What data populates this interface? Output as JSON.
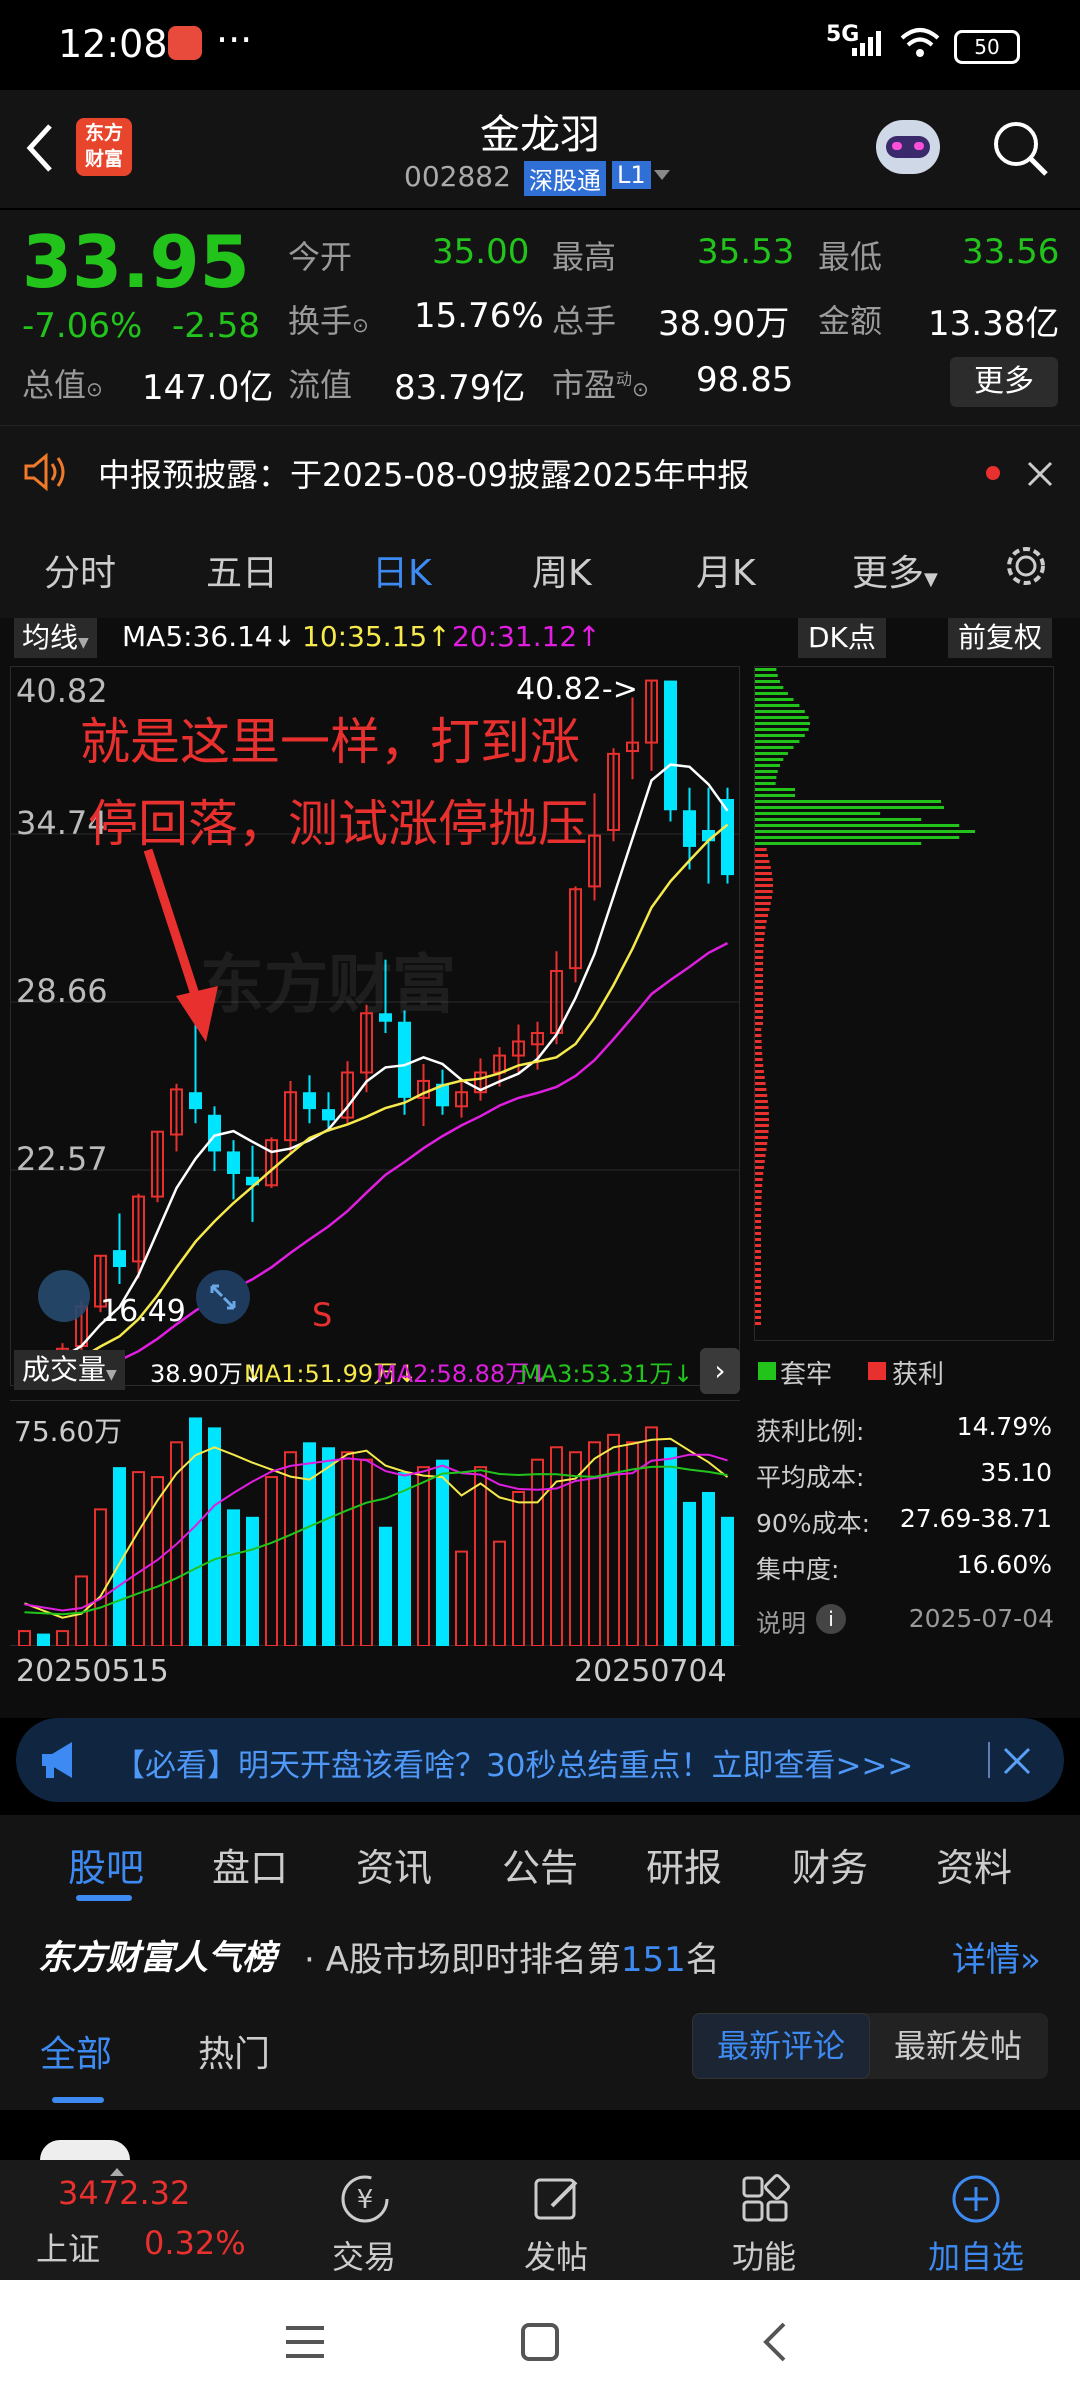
{
  "status_bar": {
    "time": "12:08",
    "dots": "···",
    "network": "5G",
    "battery": "50"
  },
  "header": {
    "title": "金龙羽",
    "code": "002882",
    "badge1": "深股通",
    "badge2": "L1",
    "logo_text": "东方财富"
  },
  "quote": {
    "price": "33.95",
    "change_pct": "-7.06%",
    "change": "-2.58",
    "open_label": "今开",
    "open_val": "35.00",
    "high_label": "最高",
    "high_val": "35.53",
    "low_label": "最低",
    "low_val": "33.56",
    "turnover_label": "换手",
    "turnover_val": "15.76%",
    "volume_label": "总手",
    "volume_val": "38.90万",
    "amount_label": "金额",
    "amount_val": "13.38亿",
    "mktcap_label": "总值",
    "mktcap_val": "147.0亿",
    "float_label": "流值",
    "float_val": "83.79亿",
    "pe_label": "市盈",
    "pe_sup": "动",
    "pe_val": "98.85",
    "more": "更多"
  },
  "notice": {
    "text": "中报预披露：于2025-08-09披露2025年中报"
  },
  "period_tabs": [
    "分时",
    "五日",
    "日K",
    "周K",
    "月K",
    "更多"
  ],
  "chart_toolbar": {
    "ma_select": "均线",
    "ma5": "MA5:36.14↓",
    "ma10": "10:35.15↑",
    "ma20": "20:31.12↑",
    "dk": "DK点",
    "fq": "前复权"
  },
  "price_axis": [
    "40.82",
    "34.74",
    "28.66",
    "22.57"
  ],
  "annotation": {
    "line1": "就是这里一样，打到涨",
    "line2": "停回落，测试涨停抛压"
  },
  "price_marks": {
    "high": "40.82->",
    "low": "16.49",
    "s_mark": "S"
  },
  "vol_toolbar": {
    "select": "成交量",
    "vol": "38.90万↓",
    "ma1": "MA1:51.99万↓",
    "ma2": "MA2:58.88万↓",
    "ma3": "MA3:53.31万↓"
  },
  "vol_axis": "75.60万",
  "dates": {
    "start": "20250515",
    "end": "20250704"
  },
  "chip": {
    "legend_trapped": "套牢",
    "legend_profit": "获利",
    "rows": [
      {
        "label": "获利比例:",
        "value": "14.79%"
      },
      {
        "label": "平均成本:",
        "value": "35.10"
      },
      {
        "label": "90%成本:",
        "value": "27.69-38.71"
      },
      {
        "label": "集中度:",
        "value": "16.60%"
      }
    ],
    "note_label": "说明",
    "date": "2025-07-04"
  },
  "ad": {
    "text": "【必看】明天开盘该看啥？30秒总结重点！立即查看>>>"
  },
  "section_tabs": [
    "股吧",
    "盘口",
    "资讯",
    "公告",
    "研报",
    "财务",
    "资料"
  ],
  "rank": {
    "brand": "东方财富人气榜",
    "prefix": "· A股市场即时排名第",
    "num": "151",
    "suffix": "名",
    "detail": "详情"
  },
  "comment_tabs": {
    "all": "全部",
    "hot": "热门",
    "latest_comment": "最新评论",
    "latest_post": "最新发帖"
  },
  "bottom_bar": {
    "index_val": "3472.32",
    "index_name": "上证",
    "index_pct": "0.32%",
    "trade": "交易",
    "post": "发帖",
    "func": "功能",
    "add": "加自选"
  },
  "colors": {
    "up": "#e8302e",
    "down": "#00e5ff",
    "green": "#22c41c",
    "accent": "#3d8bf2",
    "ma5": "#ffffff",
    "ma10": "#f5e94b",
    "ma20": "#e01ee0"
  },
  "chart_data": {
    "type": "candlestick",
    "xlabels": [
      "20250515",
      "20250704"
    ],
    "ylim": [
      16.49,
      40.82
    ],
    "candles": [
      [
        16.8,
        16.9,
        16.5,
        16.9
      ],
      [
        16.9,
        17.0,
        16.7,
        16.8
      ],
      [
        16.8,
        17.3,
        16.7,
        17.1
      ],
      [
        17.2,
        18.8,
        17.0,
        18.6
      ],
      [
        18.6,
        20.4,
        18.4,
        20.4
      ],
      [
        20.6,
        21.9,
        19.4,
        20.0
      ],
      [
        20.2,
        22.6,
        19.6,
        22.5
      ],
      [
        22.5,
        24.8,
        22.3,
        24.8
      ],
      [
        24.7,
        26.5,
        24.1,
        26.3
      ],
      [
        26.2,
        29.2,
        25.1,
        25.6
      ],
      [
        25.4,
        25.7,
        23.4,
        24.1
      ],
      [
        24.1,
        24.5,
        22.4,
        23.3
      ],
      [
        23.2,
        24.3,
        21.6,
        22.9
      ],
      [
        22.9,
        24.6,
        22.8,
        24.5
      ],
      [
        24.5,
        26.6,
        24.0,
        26.2
      ],
      [
        26.2,
        26.8,
        25.1,
        25.6
      ],
      [
        25.6,
        26.2,
        24.8,
        25.2
      ],
      [
        25.3,
        27.3,
        25.1,
        26.9
      ],
      [
        26.9,
        29.3,
        26.2,
        29.0
      ],
      [
        29.0,
        30.9,
        28.3,
        28.7
      ],
      [
        28.7,
        29.1,
        25.4,
        26.0
      ],
      [
        26.0,
        27.2,
        25.0,
        26.6
      ],
      [
        26.5,
        27.0,
        25.4,
        25.7
      ],
      [
        25.7,
        26.6,
        25.3,
        26.2
      ],
      [
        26.2,
        27.4,
        25.9,
        26.9
      ],
      [
        26.9,
        27.8,
        26.4,
        27.5
      ],
      [
        27.5,
        28.6,
        26.9,
        28.0
      ],
      [
        27.9,
        28.7,
        27.0,
        28.3
      ],
      [
        28.3,
        31.2,
        27.9,
        30.5
      ],
      [
        30.6,
        33.5,
        30.1,
        33.4
      ],
      [
        33.5,
        36.8,
        33.0,
        35.3
      ],
      [
        35.5,
        38.4,
        35.1,
        38.2
      ],
      [
        38.3,
        40.2,
        37.3,
        38.6
      ],
      [
        38.6,
        40.8,
        37.6,
        40.8
      ],
      [
        40.8,
        40.8,
        35.8,
        36.2
      ],
      [
        36.2,
        37.0,
        34.1,
        34.9
      ],
      [
        35.5,
        37.0,
        33.6,
        35.1
      ],
      [
        36.6,
        37.0,
        33.6,
        33.9
      ]
    ],
    "volume": [
      6,
      5,
      6,
      28,
      55,
      72,
      70,
      68,
      82,
      92,
      88,
      55,
      52,
      68,
      78,
      82,
      80,
      78,
      75,
      48,
      70,
      72,
      75,
      38,
      72,
      42,
      62,
      75,
      80,
      78,
      82,
      85,
      82,
      88,
      80,
      58,
      62,
      52
    ],
    "vol_ylim": [
      0,
      95
    ]
  }
}
